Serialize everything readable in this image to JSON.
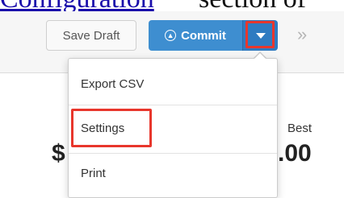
{
  "doc": {
    "link_text": "Configuration",
    "rest_text": "section of"
  },
  "toolbar": {
    "save_draft_label": "Save Draft",
    "commit_label": "Commit",
    "more_symbol": "»"
  },
  "panel": {
    "best_label": "Best",
    "amount_left": "$",
    "amount_right": ".00"
  },
  "menu": {
    "items": [
      {
        "label": "Export CSV"
      },
      {
        "label": "Settings"
      },
      {
        "label": "Print"
      }
    ]
  },
  "colors": {
    "primary": "#3e8ed0",
    "highlight": "#e8362c"
  }
}
